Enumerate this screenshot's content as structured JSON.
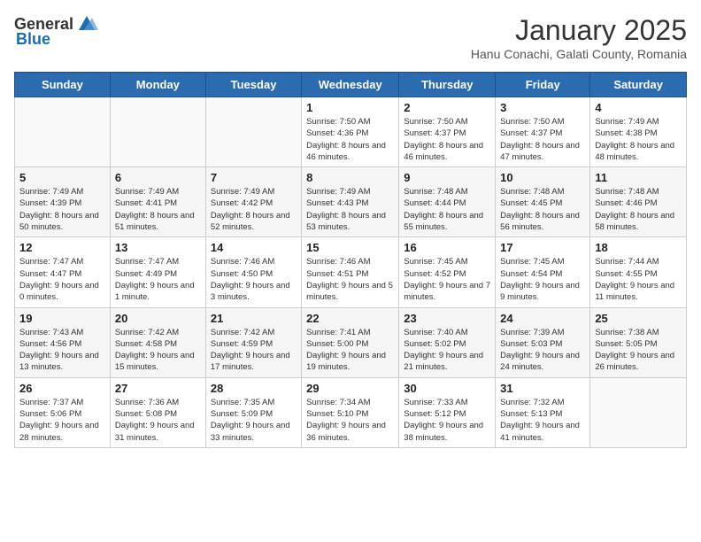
{
  "header": {
    "logo_general": "General",
    "logo_blue": "Blue",
    "month_title": "January 2025",
    "subtitle": "Hanu Conachi, Galati County, Romania"
  },
  "days_of_week": [
    "Sunday",
    "Monday",
    "Tuesday",
    "Wednesday",
    "Thursday",
    "Friday",
    "Saturday"
  ],
  "weeks": [
    [
      {
        "day": "",
        "info": ""
      },
      {
        "day": "",
        "info": ""
      },
      {
        "day": "",
        "info": ""
      },
      {
        "day": "1",
        "info": "Sunrise: 7:50 AM\nSunset: 4:36 PM\nDaylight: 8 hours and 46 minutes."
      },
      {
        "day": "2",
        "info": "Sunrise: 7:50 AM\nSunset: 4:37 PM\nDaylight: 8 hours and 46 minutes."
      },
      {
        "day": "3",
        "info": "Sunrise: 7:50 AM\nSunset: 4:37 PM\nDaylight: 8 hours and 47 minutes."
      },
      {
        "day": "4",
        "info": "Sunrise: 7:49 AM\nSunset: 4:38 PM\nDaylight: 8 hours and 48 minutes."
      }
    ],
    [
      {
        "day": "5",
        "info": "Sunrise: 7:49 AM\nSunset: 4:39 PM\nDaylight: 8 hours and 50 minutes."
      },
      {
        "day": "6",
        "info": "Sunrise: 7:49 AM\nSunset: 4:41 PM\nDaylight: 8 hours and 51 minutes."
      },
      {
        "day": "7",
        "info": "Sunrise: 7:49 AM\nSunset: 4:42 PM\nDaylight: 8 hours and 52 minutes."
      },
      {
        "day": "8",
        "info": "Sunrise: 7:49 AM\nSunset: 4:43 PM\nDaylight: 8 hours and 53 minutes."
      },
      {
        "day": "9",
        "info": "Sunrise: 7:48 AM\nSunset: 4:44 PM\nDaylight: 8 hours and 55 minutes."
      },
      {
        "day": "10",
        "info": "Sunrise: 7:48 AM\nSunset: 4:45 PM\nDaylight: 8 hours and 56 minutes."
      },
      {
        "day": "11",
        "info": "Sunrise: 7:48 AM\nSunset: 4:46 PM\nDaylight: 8 hours and 58 minutes."
      }
    ],
    [
      {
        "day": "12",
        "info": "Sunrise: 7:47 AM\nSunset: 4:47 PM\nDaylight: 9 hours and 0 minutes."
      },
      {
        "day": "13",
        "info": "Sunrise: 7:47 AM\nSunset: 4:49 PM\nDaylight: 9 hours and 1 minute."
      },
      {
        "day": "14",
        "info": "Sunrise: 7:46 AM\nSunset: 4:50 PM\nDaylight: 9 hours and 3 minutes."
      },
      {
        "day": "15",
        "info": "Sunrise: 7:46 AM\nSunset: 4:51 PM\nDaylight: 9 hours and 5 minutes."
      },
      {
        "day": "16",
        "info": "Sunrise: 7:45 AM\nSunset: 4:52 PM\nDaylight: 9 hours and 7 minutes."
      },
      {
        "day": "17",
        "info": "Sunrise: 7:45 AM\nSunset: 4:54 PM\nDaylight: 9 hours and 9 minutes."
      },
      {
        "day": "18",
        "info": "Sunrise: 7:44 AM\nSunset: 4:55 PM\nDaylight: 9 hours and 11 minutes."
      }
    ],
    [
      {
        "day": "19",
        "info": "Sunrise: 7:43 AM\nSunset: 4:56 PM\nDaylight: 9 hours and 13 minutes."
      },
      {
        "day": "20",
        "info": "Sunrise: 7:42 AM\nSunset: 4:58 PM\nDaylight: 9 hours and 15 minutes."
      },
      {
        "day": "21",
        "info": "Sunrise: 7:42 AM\nSunset: 4:59 PM\nDaylight: 9 hours and 17 minutes."
      },
      {
        "day": "22",
        "info": "Sunrise: 7:41 AM\nSunset: 5:00 PM\nDaylight: 9 hours and 19 minutes."
      },
      {
        "day": "23",
        "info": "Sunrise: 7:40 AM\nSunset: 5:02 PM\nDaylight: 9 hours and 21 minutes."
      },
      {
        "day": "24",
        "info": "Sunrise: 7:39 AM\nSunset: 5:03 PM\nDaylight: 9 hours and 24 minutes."
      },
      {
        "day": "25",
        "info": "Sunrise: 7:38 AM\nSunset: 5:05 PM\nDaylight: 9 hours and 26 minutes."
      }
    ],
    [
      {
        "day": "26",
        "info": "Sunrise: 7:37 AM\nSunset: 5:06 PM\nDaylight: 9 hours and 28 minutes."
      },
      {
        "day": "27",
        "info": "Sunrise: 7:36 AM\nSunset: 5:08 PM\nDaylight: 9 hours and 31 minutes."
      },
      {
        "day": "28",
        "info": "Sunrise: 7:35 AM\nSunset: 5:09 PM\nDaylight: 9 hours and 33 minutes."
      },
      {
        "day": "29",
        "info": "Sunrise: 7:34 AM\nSunset: 5:10 PM\nDaylight: 9 hours and 36 minutes."
      },
      {
        "day": "30",
        "info": "Sunrise: 7:33 AM\nSunset: 5:12 PM\nDaylight: 9 hours and 38 minutes."
      },
      {
        "day": "31",
        "info": "Sunrise: 7:32 AM\nSunset: 5:13 PM\nDaylight: 9 hours and 41 minutes."
      },
      {
        "day": "",
        "info": ""
      }
    ]
  ]
}
